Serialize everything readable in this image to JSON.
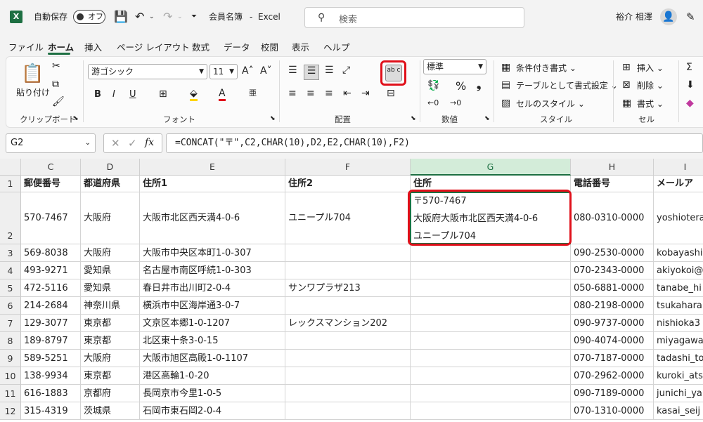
{
  "titlebar": {
    "autosave_label": "自動保存",
    "toggle_state": "オフ",
    "doc_title": "会員名簿",
    "separator": "-",
    "app_name": "Excel",
    "search_placeholder": "検索",
    "user_name": "裕介 相澤"
  },
  "menu": {
    "tabs": [
      "ファイル",
      "ホーム",
      "挿入",
      "ページ レイアウト",
      "数式",
      "データ",
      "校閲",
      "表示",
      "ヘルプ"
    ],
    "active": "ホーム"
  },
  "ribbon": {
    "clipboard": {
      "paste": "貼り付け",
      "label": "クリップボード"
    },
    "font": {
      "name": "游ゴシック",
      "size": "11",
      "label": "フォント",
      "bold": "B",
      "italic": "I",
      "underline": "U"
    },
    "alignment": {
      "label": "配置",
      "wrap_text": "ab c"
    },
    "number": {
      "format": "標準",
      "label": "数値",
      "percent": "%",
      "comma": "❟"
    },
    "styles": {
      "conditional": "条件付き書式",
      "table": "テーブルとして書式設定",
      "cell": "セルのスタイル",
      "label": "スタイル"
    },
    "cells": {
      "insert": "挿入",
      "delete": "削除",
      "format": "書式",
      "label": "セル"
    }
  },
  "formula_bar": {
    "name_box": "G2",
    "fx": "fx",
    "formula": "=CONCAT(\"〒\",C2,CHAR(10),D2,E2,CHAR(10),F2)"
  },
  "grid": {
    "columns": [
      "C",
      "D",
      "E",
      "F",
      "G",
      "H",
      "I"
    ],
    "active_column": "G",
    "rows": [
      [
        "1",
        "郵便番号",
        "都道府県",
        "住所1",
        "住所2",
        "住所",
        "電話番号",
        "メールア"
      ],
      [
        "2",
        "570-7467",
        "大阪府",
        "大阪市北区西天満4-0-6",
        "ユニープル704",
        "〒570-7467\n大阪府大阪市北区西天満4-0-6\nユニープル704",
        "080-0310-0000",
        "yoshiotera"
      ],
      [
        "3",
        "569-8038",
        "大阪府",
        "大阪市中央区本町1-0-307",
        "",
        "",
        "090-2530-0000",
        "kobayashi"
      ],
      [
        "4",
        "493-9271",
        "愛知県",
        "名古屋市南区呼続1-0-303",
        "",
        "",
        "070-2343-0000",
        "akiyokoi@"
      ],
      [
        "5",
        "472-5116",
        "愛知県",
        "春日井市出川町2-0-4",
        "サンワプラザ213",
        "",
        "050-6881-0000",
        "tanabe_hi"
      ],
      [
        "6",
        "214-2684",
        "神奈川県",
        "横浜市中区海岸通3-0-7",
        "",
        "",
        "080-2198-0000",
        "tsukahara"
      ],
      [
        "7",
        "129-3077",
        "東京都",
        "文京区本郷1-0-1207",
        "レックスマンション202",
        "",
        "090-9737-0000",
        "nishioka3"
      ],
      [
        "8",
        "189-8797",
        "東京都",
        "北区東十条3-0-15",
        "",
        "",
        "090-4074-0000",
        "miyagawa"
      ],
      [
        "9",
        "589-5251",
        "大阪府",
        "大阪市旭区高殿1-0-1107",
        "",
        "",
        "070-7187-0000",
        "tadashi_to"
      ],
      [
        "10",
        "138-9934",
        "東京都",
        "港区高輪1-0-20",
        "",
        "",
        "070-2962-0000",
        "kuroki_ats"
      ],
      [
        "11",
        "616-1883",
        "京都府",
        "長岡京市今里1-0-5",
        "",
        "",
        "090-7189-0000",
        "junichi_ya"
      ],
      [
        "12",
        "315-4319",
        "茨城県",
        "石岡市東石岡2-0-4",
        "",
        "",
        "070-1310-0000",
        "kasai_seij"
      ]
    ]
  }
}
